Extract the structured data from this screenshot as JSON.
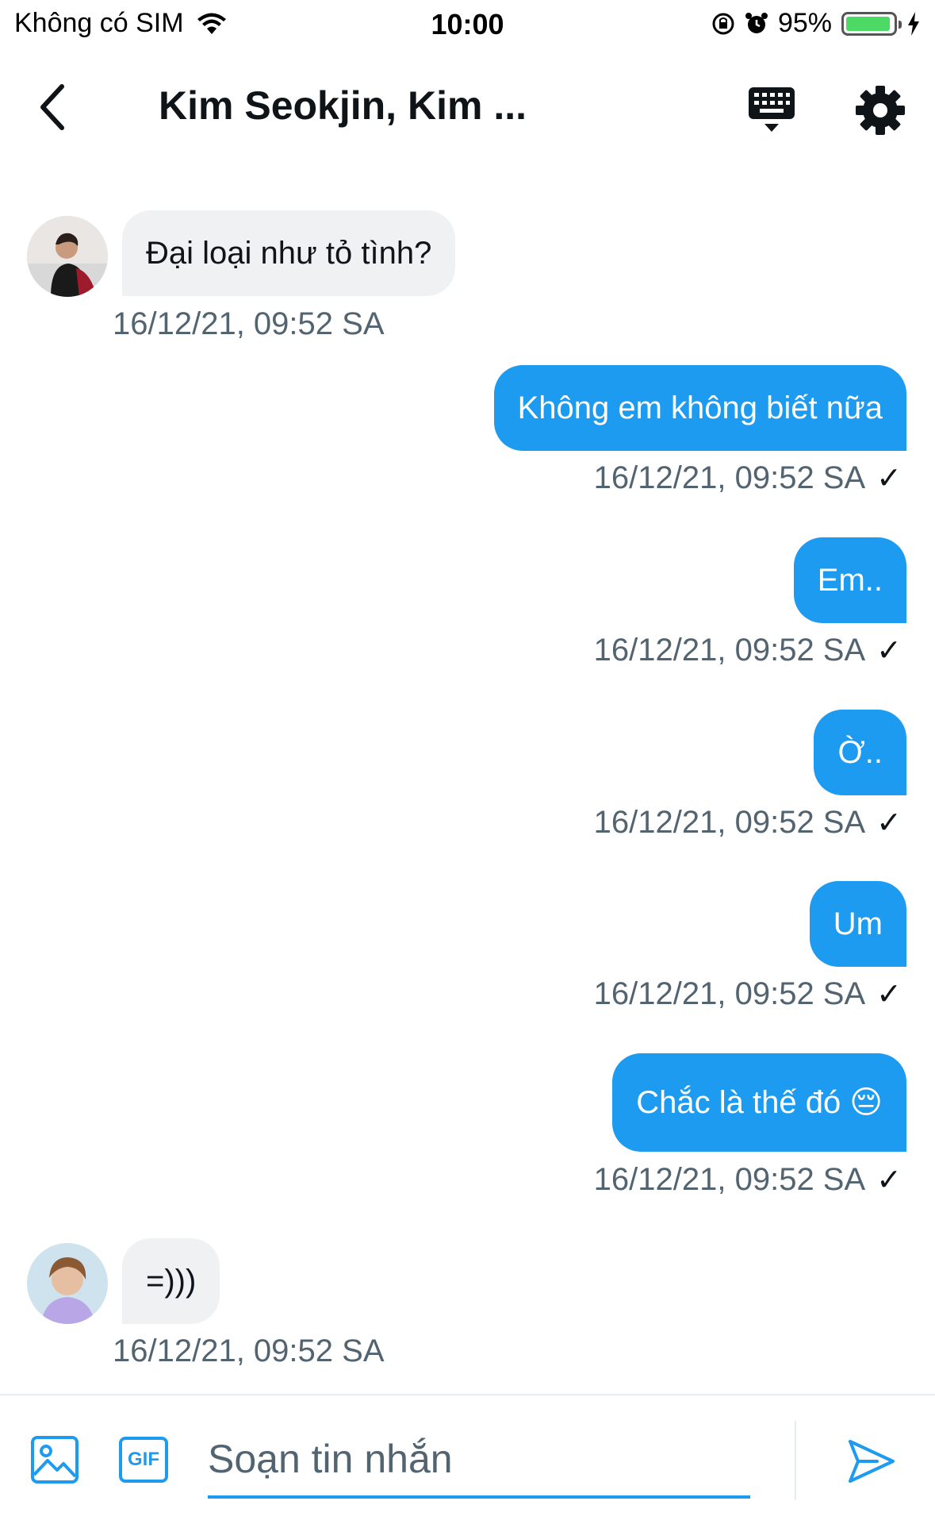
{
  "status": {
    "carrier": "Không có SIM",
    "time": "10:00",
    "battery_percent": "95%",
    "battery_level": 0.95,
    "battery_color": "#4cd964"
  },
  "header": {
    "title": "Kim Seokjin, Kim ...",
    "back_icon": "chevron-left-icon",
    "keyboard_icon": "keyboard-icon",
    "settings_icon": "gear-icon"
  },
  "messages": [
    {
      "direction": "in",
      "text": "Đại loại như tỏ tình?",
      "timestamp": "16/12/21, 09:52 SA"
    },
    {
      "direction": "out",
      "text": "Không em không biết nữa",
      "timestamp": "16/12/21, 09:52 SA",
      "status": "✓"
    },
    {
      "direction": "out",
      "text": "Em..",
      "timestamp": "16/12/21, 09:52 SA",
      "status": "✓"
    },
    {
      "direction": "out",
      "text": "Ờ..",
      "timestamp": "16/12/21, 09:52 SA",
      "status": "✓"
    },
    {
      "direction": "out",
      "text": "Um",
      "timestamp": "16/12/21, 09:52 SA",
      "status": "✓"
    },
    {
      "direction": "out",
      "text": "Chắc là thế đó 😔",
      "timestamp": "16/12/21, 09:52 SA",
      "status": "✓"
    },
    {
      "direction": "in",
      "text": "=)))",
      "timestamp": "16/12/21, 09:52 SA"
    }
  ],
  "composer": {
    "placeholder": "Soạn tin nhắn",
    "gif_label": "GIF",
    "image_icon": "image-icon",
    "send_icon": "send-icon"
  },
  "colors": {
    "accent": "#1d9bf0",
    "incoming_bubble": "#eff1f3",
    "timestamp": "#536471"
  }
}
